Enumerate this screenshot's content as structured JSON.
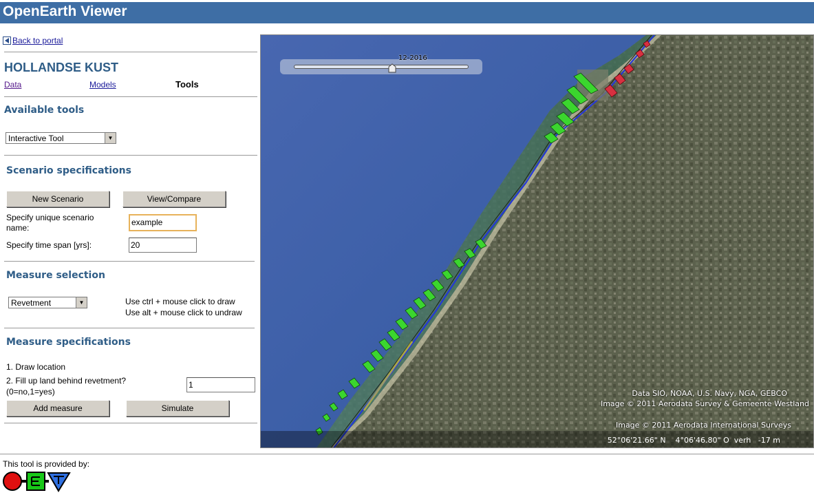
{
  "app": {
    "title": "OpenEarth Viewer"
  },
  "nav": {
    "back_label": "Back to portal"
  },
  "region": {
    "title": "HOLLANDSE KUST"
  },
  "tabs": [
    {
      "label": "Data",
      "active": false
    },
    {
      "label": "Models",
      "active": false
    },
    {
      "label": "Tools",
      "active": true
    }
  ],
  "tools": {
    "heading": "Available tools",
    "selected": "Interactive Tool"
  },
  "scenario": {
    "heading": "Scenario specifications",
    "new_button": "New Scenario",
    "view_button": "View/Compare",
    "name_label": "Specify unique scenario name:",
    "name_value": "example",
    "span_label": "Specify time span [yrs]:",
    "span_value": "20"
  },
  "measure": {
    "heading": "Measure selection",
    "selected": "Revetment",
    "hint_draw": "Use ctrl + mouse click to draw",
    "hint_undraw": "Use alt + mouse click to undraw"
  },
  "measure_spec": {
    "heading": "Measure specifications",
    "step1": "1. Draw location",
    "step2_line1": "2. Fill up land behind revetment?",
    "step2_line2": "(0=no,1=yes)",
    "fill_value": "1",
    "add_button": "Add measure",
    "simulate_button": "Simulate"
  },
  "map": {
    "time_label": "12-2016",
    "slider_fraction": 0.55,
    "credit1": "Data SIO, NOAA, U.S. Navy, NGA, GEBCO",
    "credit2": "Image © 2011 Aerodata Survey & Gemeente Westland",
    "credit3": "Image © 2011 Aerodata International Surveys",
    "coords": "52°06'21.66\" N    4°06'46.80\" O  verh   -17 m"
  },
  "footer": {
    "provided_by": "This tool is provided by:"
  },
  "colors": {
    "titlebar": "#3e6ea5",
    "heading": "#2f5d87",
    "sea": "#3b5fa8",
    "land": "#6b6d58",
    "bar_green": "#3bd62e",
    "bar_red": "#d83040"
  }
}
